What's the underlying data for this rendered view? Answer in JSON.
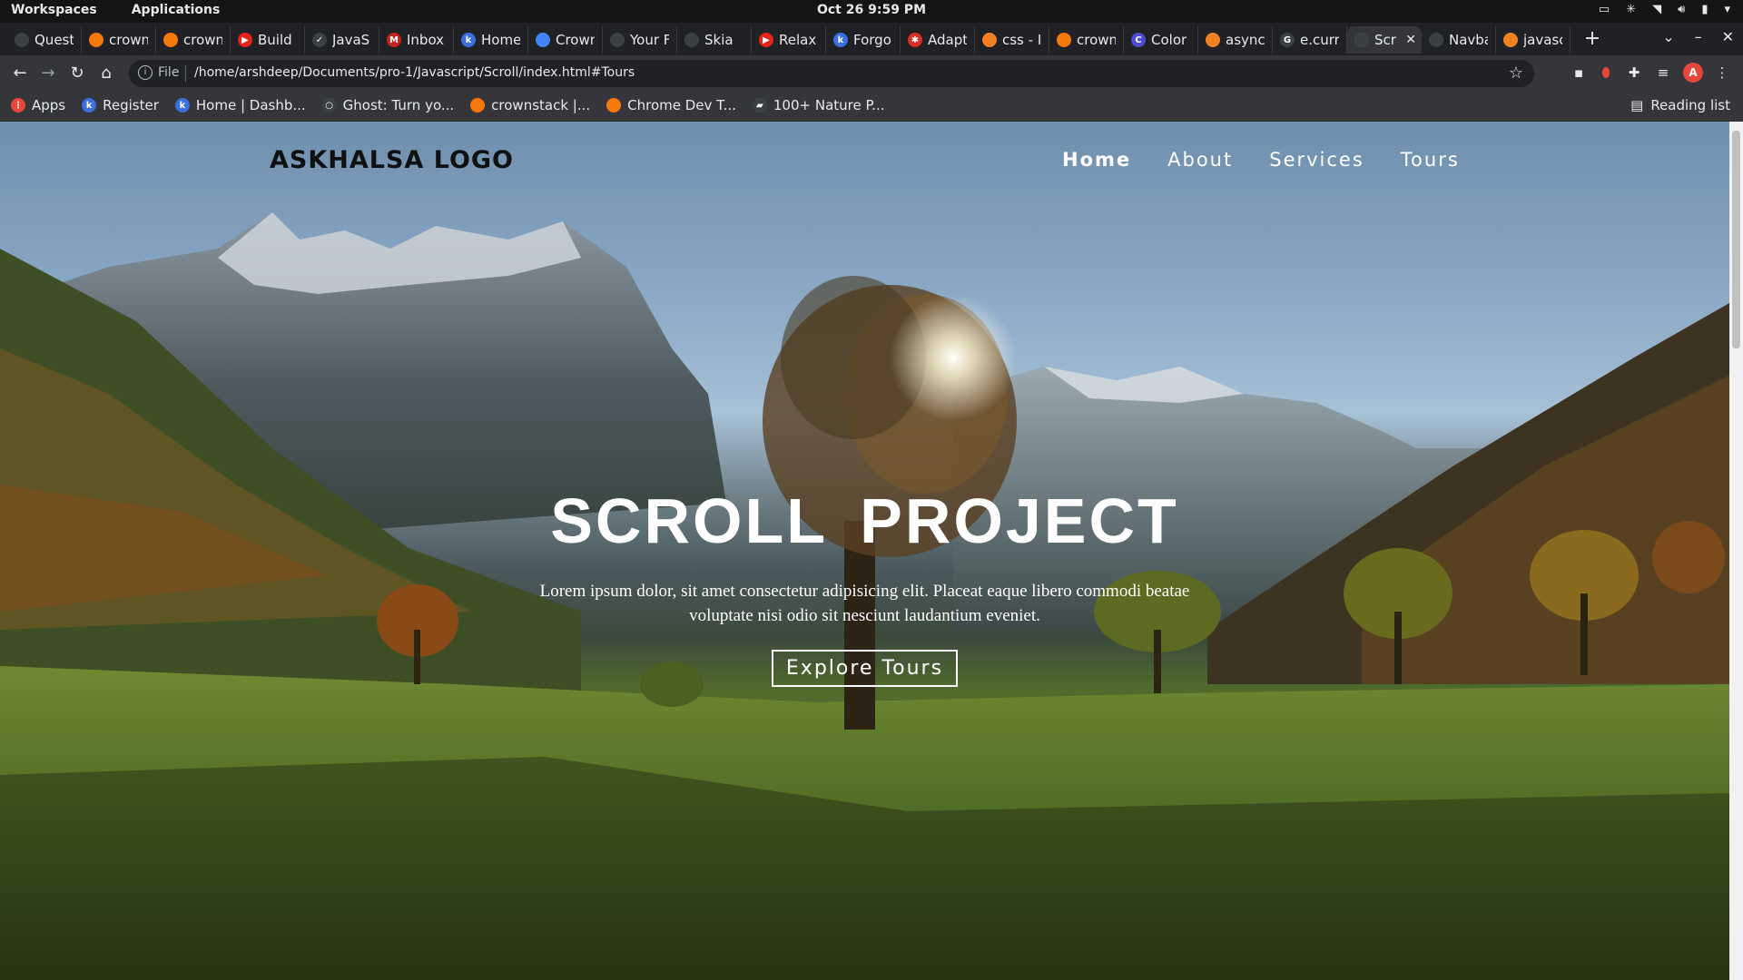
{
  "os": {
    "workspaces": "Workspaces",
    "applications": "Applications",
    "clock": "Oct 26   9:59 PM"
  },
  "browser": {
    "tabs": [
      {
        "label": "Quest",
        "color": "#3c4043",
        "glyph": ""
      },
      {
        "label": "crown",
        "color": "#f4780b",
        "glyph": ""
      },
      {
        "label": "crown",
        "color": "#f4780b",
        "glyph": ""
      },
      {
        "label": "Build",
        "color": "#e62117",
        "glyph": "▶"
      },
      {
        "label": "JavaS",
        "color": "#3c4043",
        "glyph": "✓"
      },
      {
        "label": "Inbox",
        "color": "#c5221f",
        "glyph": "M"
      },
      {
        "label": "Home",
        "color": "#3b6fe0",
        "glyph": "k"
      },
      {
        "label": "Crown",
        "color": "#4285f4",
        "glyph": ""
      },
      {
        "label": "Your F",
        "color": "#3c4043",
        "glyph": ""
      },
      {
        "label": "Skia",
        "color": "#3c4043",
        "glyph": ""
      },
      {
        "label": "Relax",
        "color": "#e62117",
        "glyph": "▶"
      },
      {
        "label": "Forgo",
        "color": "#3b6fe0",
        "glyph": "k"
      },
      {
        "label": "Adapt",
        "color": "#d93025",
        "glyph": "✱"
      },
      {
        "label": "css - I",
        "color": "#f48024",
        "glyph": ""
      },
      {
        "label": "crown",
        "color": "#f4780b",
        "glyph": ""
      },
      {
        "label": "Color",
        "color": "#4b4bd6",
        "glyph": "C"
      },
      {
        "label": "async",
        "color": "#f48024",
        "glyph": ""
      },
      {
        "label": "e.curr",
        "color": "#3c4043",
        "glyph": "G"
      },
      {
        "label": "Scr",
        "color": "#3c4043",
        "glyph": "",
        "active": true
      },
      {
        "label": "Navba",
        "color": "#3c4043",
        "glyph": ""
      },
      {
        "label": "javasc",
        "color": "#f48024",
        "glyph": ""
      }
    ],
    "address": {
      "scheme": "File",
      "url": "/home/arshdeep/Documents/pro-1/Javascript/Scroll/index.html#Tours"
    },
    "profile_initial": "A",
    "bookmarks": [
      {
        "label": "Apps",
        "color": "#e8453c",
        "glyph": "⋮"
      },
      {
        "label": "Register",
        "color": "#3b6fe0",
        "glyph": "k"
      },
      {
        "label": "Home | Dashb...",
        "color": "#3b6fe0",
        "glyph": "k"
      },
      {
        "label": "Ghost: Turn yo...",
        "color": "#3c4043",
        "glyph": "○"
      },
      {
        "label": "crownstack |...",
        "color": "#f4780b",
        "glyph": ""
      },
      {
        "label": "Chrome Dev T...",
        "color": "#f4780b",
        "glyph": ""
      },
      {
        "label": "100+ Nature P...",
        "color": "#3c4043",
        "glyph": "▰"
      }
    ],
    "reading_list": "Reading list"
  },
  "page": {
    "logo": "ASKHALSA LOGO",
    "nav": [
      {
        "label": "Home",
        "active": true
      },
      {
        "label": "About"
      },
      {
        "label": "Services"
      },
      {
        "label": "Tours"
      }
    ],
    "hero": {
      "title": "SCROLL PROJECT",
      "text": "Lorem ipsum dolor, sit amet consectetur adipisicing elit. Placeat eaque libero commodi beatae voluptate nisi odio sit nesciunt laudantium eveniet.",
      "button": "Explore Tours"
    }
  }
}
